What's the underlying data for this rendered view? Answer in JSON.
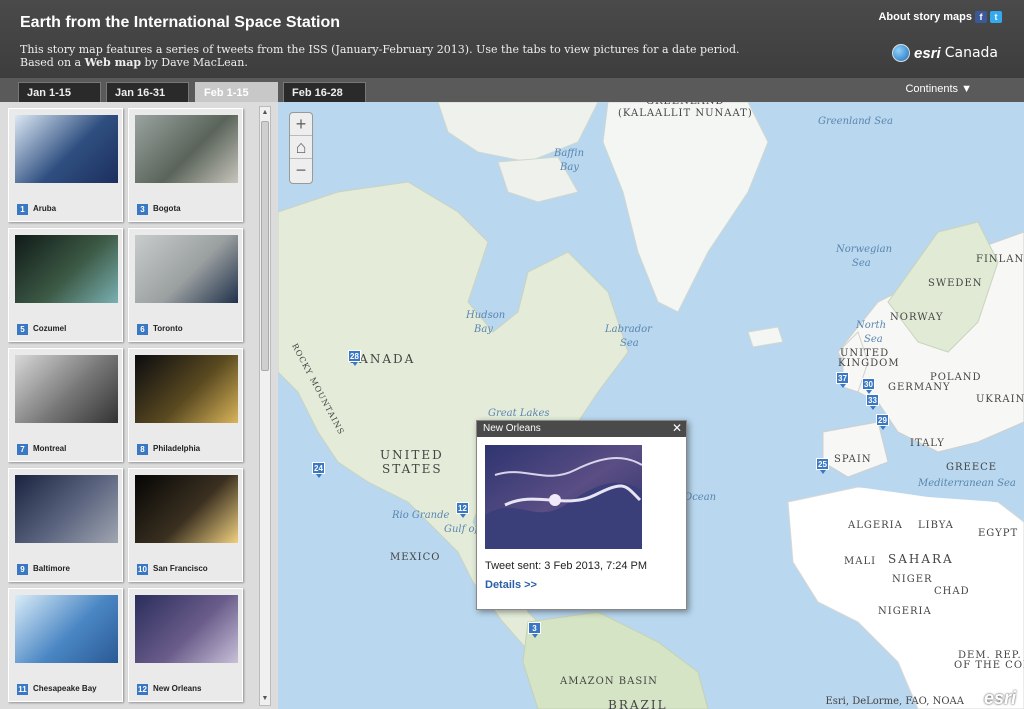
{
  "header": {
    "title": "Earth from the International Space Station",
    "subtitle_pre": "This story map features a series of tweets from the ISS (January-February 2013). Use the tabs to view pictures for a date period. Based on a ",
    "subtitle_link": "Web map",
    "subtitle_post": " by Dave MacLean.",
    "about": "About story maps",
    "facebook_glyph": "f",
    "twitter_glyph": "t",
    "brand_esri": "esri",
    "brand_canada": "Canada"
  },
  "tabs": [
    {
      "label": "Jan 1-15",
      "active": false
    },
    {
      "label": "Jan 16-31",
      "active": false
    },
    {
      "label": "Feb 1-15",
      "active": true
    },
    {
      "label": "Feb 16-28",
      "active": false
    }
  ],
  "continents": "Continents ▼",
  "thumbnails": [
    {
      "num": "1",
      "label": "Aruba",
      "colors": [
        "#dbe8f4",
        "#2f4f80",
        "#1c2f5c"
      ]
    },
    {
      "num": "3",
      "label": "Bogota",
      "colors": [
        "#9aa3a0",
        "#5a645a",
        "#c7c5bb"
      ]
    },
    {
      "num": "5",
      "label": "Cozumel",
      "colors": [
        "#101a18",
        "#3c5a45",
        "#7ab0b2"
      ]
    },
    {
      "num": "6",
      "label": "Toronto",
      "colors": [
        "#c8cccd",
        "#9a9fa0",
        "#20314a"
      ]
    },
    {
      "num": "7",
      "label": "Montreal",
      "colors": [
        "#d8d8d8",
        "#777",
        "#333"
      ]
    },
    {
      "num": "8",
      "label": "Philadelphia",
      "colors": [
        "#0b0b10",
        "#5a4a20",
        "#d9b45a"
      ]
    },
    {
      "num": "9",
      "label": "Baltimore",
      "colors": [
        "#1a2440",
        "#5c6680",
        "#a0a5b0"
      ]
    },
    {
      "num": "10",
      "label": "San Francisco",
      "colors": [
        "#050505",
        "#3a3020",
        "#f0d080"
      ]
    },
    {
      "num": "11",
      "label": "Chesapeake Bay",
      "colors": [
        "#d9ecf8",
        "#4a86c4",
        "#2a5a94"
      ]
    },
    {
      "num": "12",
      "label": "New Orleans",
      "colors": [
        "#2a2d5c",
        "#6a5c8a",
        "#c8c0d8"
      ]
    }
  ],
  "map": {
    "labels": [
      {
        "text": "GREENLAND",
        "cls": "",
        "name": "label-greenland"
      },
      {
        "text": "(KALAALLIT NUNAAT)",
        "cls": "",
        "name": "label-kalaallit"
      },
      {
        "text": "Greenland Sea",
        "cls": "sea",
        "name": "label-greenland-sea"
      },
      {
        "text": "Baffin",
        "cls": "sea",
        "name": "label-baffin"
      },
      {
        "text": "Bay",
        "cls": "sea",
        "name": "label-baffin-bay"
      },
      {
        "text": "Norwegian",
        "cls": "sea",
        "name": "label-norwegian"
      },
      {
        "text": "Sea",
        "cls": "sea",
        "name": "label-norwegian-sea"
      },
      {
        "text": "Hudson",
        "cls": "sea",
        "name": "label-hudson"
      },
      {
        "text": "Bay",
        "cls": "sea",
        "name": "label-hudson-bay"
      },
      {
        "text": "Labrador",
        "cls": "sea",
        "name": "label-labrador"
      },
      {
        "text": "Sea",
        "cls": "sea",
        "name": "label-labrador-sea"
      },
      {
        "text": "CANADA",
        "cls": "big",
        "name": "label-canada"
      },
      {
        "text": "ROCKY MOUNTAINS",
        "cls": "",
        "name": "label-rocky"
      },
      {
        "text": "UNITED",
        "cls": "big",
        "name": "label-united"
      },
      {
        "text": "STATES",
        "cls": "big",
        "name": "label-states"
      },
      {
        "text": "MEXICO",
        "cls": "",
        "name": "label-mexico"
      },
      {
        "text": "Ocean",
        "cls": "sea",
        "name": "label-ocean"
      },
      {
        "text": "North",
        "cls": "sea",
        "name": "label-north"
      },
      {
        "text": "Sea",
        "cls": "sea",
        "name": "label-north-sea"
      },
      {
        "text": "UNITED",
        "cls": "",
        "name": "label-uk1"
      },
      {
        "text": "KINGDOM",
        "cls": "",
        "name": "label-uk2"
      },
      {
        "text": "GERMANY",
        "cls": "",
        "name": "label-germany"
      },
      {
        "text": "POLAND",
        "cls": "",
        "name": "label-poland"
      },
      {
        "text": "UKRAINE",
        "cls": "",
        "name": "label-ukraine"
      },
      {
        "text": "SWEDEN",
        "cls": "",
        "name": "label-sweden"
      },
      {
        "text": "FINLAND",
        "cls": "",
        "name": "label-finland"
      },
      {
        "text": "NORWAY",
        "cls": "",
        "name": "label-norway"
      },
      {
        "text": "ITALY",
        "cls": "",
        "name": "label-italy"
      },
      {
        "text": "SPAIN",
        "cls": "",
        "name": "label-spain"
      },
      {
        "text": "GREECE",
        "cls": "",
        "name": "label-greece"
      },
      {
        "text": "Mediterranean Sea",
        "cls": "sea",
        "name": "label-med"
      },
      {
        "text": "ALGERIA",
        "cls": "",
        "name": "label-algeria"
      },
      {
        "text": "LIBYA",
        "cls": "",
        "name": "label-libya"
      },
      {
        "text": "EGYPT",
        "cls": "",
        "name": "label-egypt"
      },
      {
        "text": "SAHARA",
        "cls": "big",
        "name": "label-sahara"
      },
      {
        "text": "MALI",
        "cls": "",
        "name": "label-mali"
      },
      {
        "text": "NIGER",
        "cls": "",
        "name": "label-niger"
      },
      {
        "text": "CHAD",
        "cls": "",
        "name": "label-chad"
      },
      {
        "text": "NIGERIA",
        "cls": "",
        "name": "label-nigeria"
      },
      {
        "text": "DEM. REP.",
        "cls": "",
        "name": "label-drc1"
      },
      {
        "text": "OF THE CONGO",
        "cls": "",
        "name": "label-drc2"
      },
      {
        "text": "AMAZON BASIN",
        "cls": "",
        "name": "label-amazon"
      },
      {
        "text": "BRAZIL",
        "cls": "big",
        "name": "label-brazil"
      },
      {
        "text": "Rio Grande",
        "cls": "sea",
        "name": "label-rio"
      },
      {
        "text": "Gulf of",
        "cls": "sea",
        "name": "label-gulf"
      },
      {
        "text": "Great Lakes",
        "cls": "sea",
        "name": "label-lakes"
      }
    ],
    "pins": [
      "28",
      "24",
      "12",
      "3",
      "37",
      "30",
      "33",
      "29",
      "25"
    ],
    "attribution": "Esri, DeLorme, FAO, NOAA",
    "brand": "esri"
  },
  "zoom": {
    "in": "+",
    "home": "⌂",
    "out": "−"
  },
  "popup": {
    "title": "New Orleans",
    "close": "✕",
    "tweet": "Tweet sent: 3 Feb 2013, 7:24 PM",
    "details": "Details >>"
  },
  "colors": {
    "accent": "#3b78c4",
    "header": "#444444",
    "land": "#e9efe0",
    "water": "#b9d7ee"
  }
}
